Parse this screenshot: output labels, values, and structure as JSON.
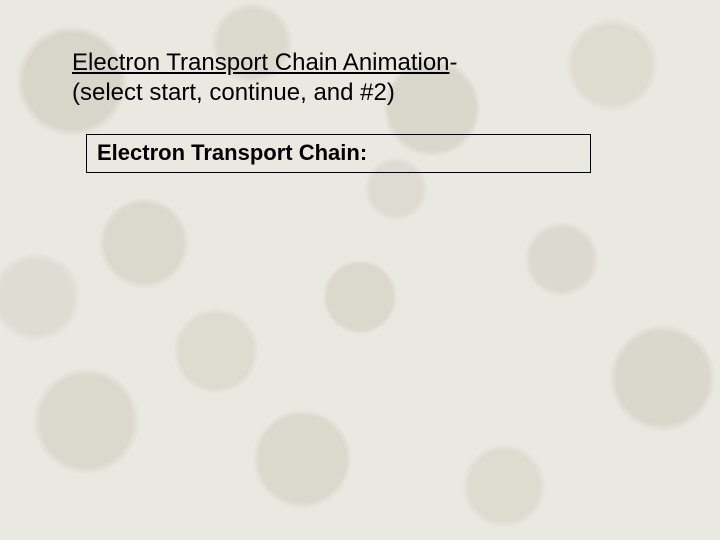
{
  "title": {
    "link_text": "Electron Transport Chain Animation",
    "suffix": "-",
    "subtitle": "(select start, continue, and #2)"
  },
  "callout": {
    "heading": "Electron Transport Chain:"
  }
}
